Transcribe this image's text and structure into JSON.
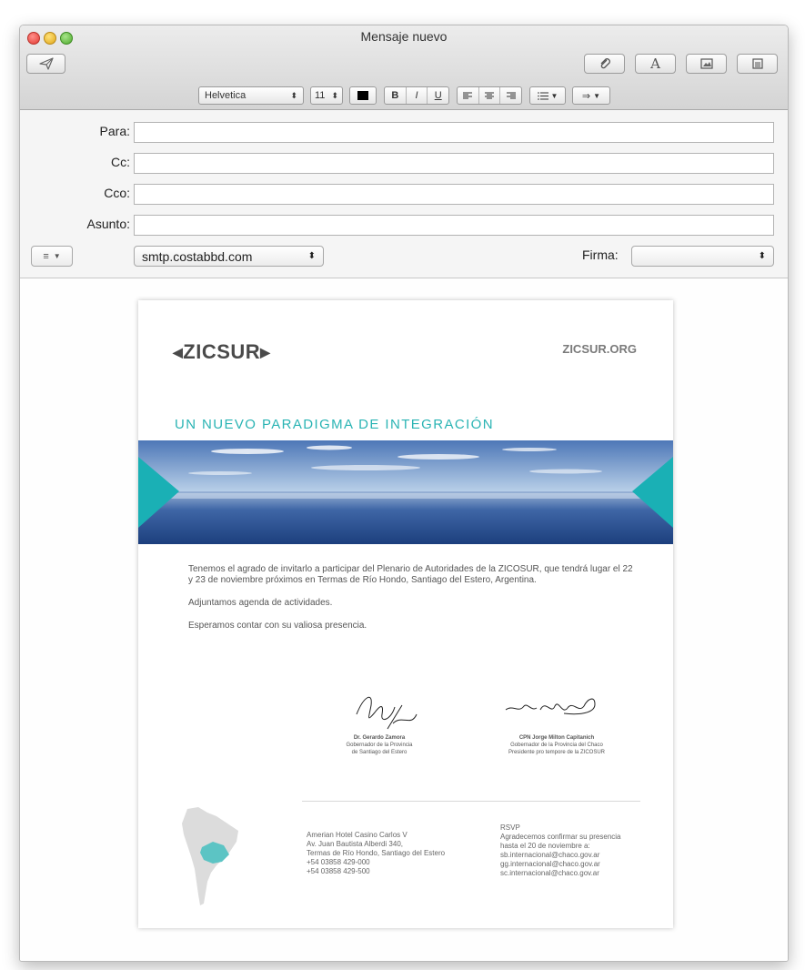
{
  "window": {
    "title": "Mensaje nuevo"
  },
  "toolbar": {
    "icons": [
      "send-icon",
      "paperclip-icon",
      "fonts-icon",
      "photo-browser-icon",
      "stationery-icon"
    ],
    "format": {
      "font": "Helvetica",
      "size": "11",
      "style_bold": "B",
      "style_italic": "I",
      "style_underline": "U"
    }
  },
  "header": {
    "to_label": "Para:",
    "cc_label": "Cc:",
    "bcc_label": "Cco:",
    "subject_label": "Asunto:",
    "to_value": "",
    "cc_value": "",
    "bcc_value": "",
    "subject_value": "",
    "account": "smtp.costabbd.com",
    "signature_label": "Firma:",
    "signature_value": ""
  },
  "email": {
    "logo": "ZICSUR",
    "site": "ZICSUR.ORG",
    "headline": "UN NUEVO PARADIGMA DE INTEGRACIÓN",
    "paragraph1": "Tenemos el agrado de invitarlo a participar del Plenario de Autoridades de la ZICOSUR,  que tendrá lugar el 22 y 23 de noviembre próximos en Termas de Río Hondo, Santiago del Estero, Argentina.",
    "paragraph2": "Adjuntamos agenda de actividades.",
    "paragraph3": "Esperamos contar con su valiosa presencia.",
    "signatures": [
      {
        "name": "Dr. Gerardo Zamora",
        "role1": "Gobernador de la Provincia",
        "role2": "de Santiago del Estero"
      },
      {
        "name": "CPN Jorge Milton Capitanich",
        "role1": "Gobernador de la Provincia del Chaco",
        "role2": "Presidente pro tempore de la ZICOSUR"
      }
    ],
    "address": [
      "Amerian Hotel Casino Carlos V",
      "Av. Juan Bautista Alberdi 340,",
      "Termas de Río Hondo, Santiago del Estero",
      "+54 03858 429-000",
      "+54 03858 429-500"
    ],
    "rsvp": [
      "RSVP",
      "Agradecemos confirmar su presencia",
      "hasta el 20 de noviembre a:",
      "sb.internacional@chaco.gov.ar",
      "gg.internacional@chaco.gov.ar",
      "sc.internacional@chaco.gov.ar"
    ]
  },
  "colors": {
    "accent": "#2ab4b4",
    "map_highlight": "#5cc4c4"
  }
}
